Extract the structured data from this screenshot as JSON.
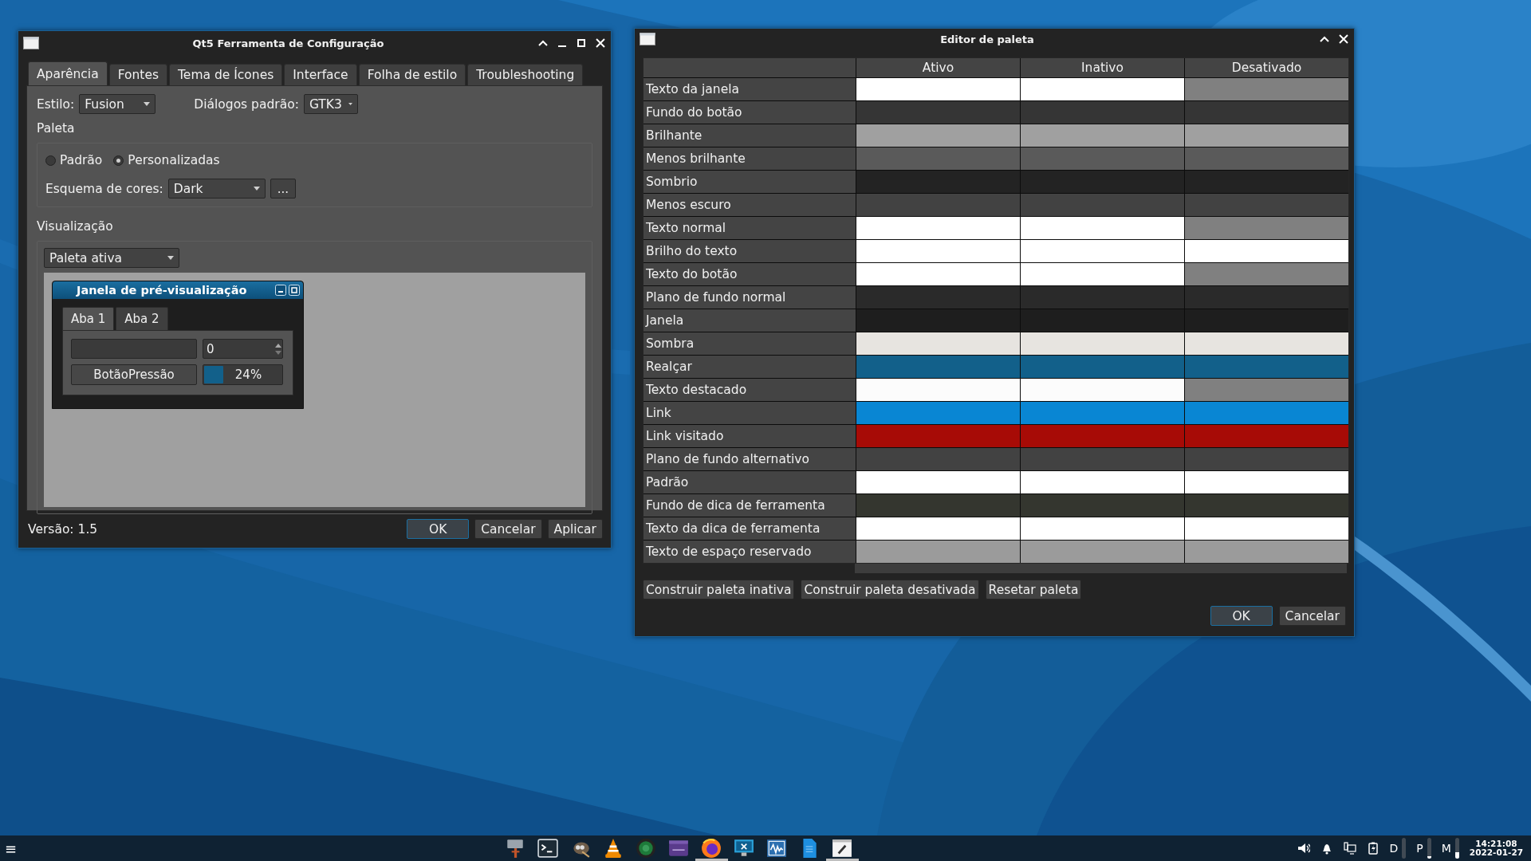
{
  "config_window": {
    "title": "Qt5 Ferramenta de Configuração",
    "tabs": [
      {
        "label": "Aparência",
        "selected": true
      },
      {
        "label": "Fontes",
        "selected": false
      },
      {
        "label": "Tema de Ícones",
        "selected": false
      },
      {
        "label": "Interface",
        "selected": false
      },
      {
        "label": "Folha de estilo",
        "selected": false
      },
      {
        "label": "Troubleshooting",
        "selected": false
      }
    ],
    "style_label": "Estilo:",
    "style_value": "Fusion",
    "dialogs_label": "Diálogos padrão:",
    "dialogs_value": "GTK3",
    "palette_heading": "Paleta",
    "palette_options": [
      {
        "label": "Padrão",
        "selected": false
      },
      {
        "label": "Personalizadas",
        "selected": true
      }
    ],
    "scheme_label": "Esquema de cores:",
    "scheme_value": "Dark",
    "scheme_button": "...",
    "preview_heading": "Visualização",
    "preview_palette": "Paleta ativa",
    "preview_window": {
      "title": "Janela de pré-visualização",
      "tabs": [
        {
          "label": "Aba 1",
          "selected": true
        },
        {
          "label": "Aba 2",
          "selected": false
        }
      ],
      "spin_value": "0",
      "push_button": "BotãoPressão",
      "progress": {
        "level": 0.24,
        "reading": "24%"
      }
    },
    "version": "Versão: 1.5",
    "buttons": [
      {
        "label": "OK",
        "default": true
      },
      {
        "label": "Cancelar",
        "default": false
      },
      {
        "label": "Aplicar",
        "default": false
      }
    ]
  },
  "palette_editor": {
    "title": "Editor de paleta",
    "columns": [
      "Ativo",
      "Inativo",
      "Desativado"
    ],
    "rows": [
      {
        "role": "Texto da janela",
        "cells": [
          {
            "color": "#ffffff"
          },
          {
            "color": "#ffffff"
          },
          {
            "color": "#808080"
          }
        ]
      },
      {
        "role": "Fundo do botão",
        "cells": [
          {
            "color": "#353535"
          },
          {
            "color": "#353535"
          },
          {
            "color": "#353535"
          }
        ]
      },
      {
        "role": "Brilhante",
        "cells": [
          {
            "color": "#a0a0a0"
          },
          {
            "color": "#a0a0a0"
          },
          {
            "color": "#a0a0a0"
          }
        ]
      },
      {
        "role": "Menos brilhante",
        "cells": [
          {
            "color": "#5a5a5a"
          },
          {
            "color": "#5a5a5a"
          },
          {
            "color": "#5a5a5a"
          }
        ]
      },
      {
        "role": "Sombrio",
        "cells": [
          {
            "color": "#232323"
          },
          {
            "color": "#232323"
          },
          {
            "color": "#232323"
          }
        ]
      },
      {
        "role": "Menos escuro",
        "cells": [
          {
            "color": "#424242"
          },
          {
            "color": "#424242"
          },
          {
            "color": "#424242"
          }
        ]
      },
      {
        "role": "Texto normal",
        "cells": [
          {
            "color": "#ffffff"
          },
          {
            "color": "#ffffff"
          },
          {
            "color": "#808080"
          }
        ]
      },
      {
        "role": "Brilho do texto",
        "cells": [
          {
            "color": "#ffffff"
          },
          {
            "color": "#ffffff"
          },
          {
            "color": "#ffffff"
          }
        ]
      },
      {
        "role": "Texto do botão",
        "cells": [
          {
            "color": "#ffffff"
          },
          {
            "color": "#ffffff"
          },
          {
            "color": "#808080"
          }
        ]
      },
      {
        "role": "Plano de fundo normal",
        "cells": [
          {
            "color": "#2a2a2a"
          },
          {
            "color": "#2a2a2a"
          },
          {
            "color": "#2a2a2a"
          }
        ]
      },
      {
        "role": "Janela",
        "cells": [
          {
            "color": "#1e1e1e"
          },
          {
            "color": "#1e1e1e"
          },
          {
            "color": "#1e1e1e"
          }
        ]
      },
      {
        "role": "Sombra",
        "cells": [
          {
            "color": "#e7e4e0"
          },
          {
            "color": "#e7e4e0"
          },
          {
            "color": "#e7e4e0"
          }
        ]
      },
      {
        "role": "Realçar",
        "cells": [
          {
            "color": "#12608a"
          },
          {
            "color": "#12608a"
          },
          {
            "color": "#12608a"
          }
        ]
      },
      {
        "role": "Texto destacado",
        "cells": [
          {
            "color": "#fcfcfc"
          },
          {
            "color": "#fcfcfc"
          },
          {
            "color": "#808080"
          }
        ]
      },
      {
        "role": "Link",
        "cells": [
          {
            "color": "#0986d3"
          },
          {
            "color": "#0986d3"
          },
          {
            "color": "#0986d3"
          }
        ]
      },
      {
        "role": "Link visitado",
        "cells": [
          {
            "color": "#a70b06"
          },
          {
            "color": "#a70b06"
          },
          {
            "color": "#a70b06"
          }
        ]
      },
      {
        "role": "Plano de fundo alternativo",
        "cells": [
          {
            "color": "#424242"
          },
          {
            "color": "#424242"
          },
          {
            "color": "#424242"
          }
        ]
      },
      {
        "role": "Padrão",
        "cells": [
          {
            "color": "#ffffff"
          },
          {
            "color": "#ffffff"
          },
          {
            "color": "#ffffff"
          }
        ]
      },
      {
        "role": "Fundo de dica de ferramenta",
        "cells": [
          {
            "color": "#34362f"
          },
          {
            "color": "#34362f"
          },
          {
            "color": "#34362f"
          }
        ]
      },
      {
        "role": "Texto da dica de ferramenta",
        "cells": [
          {
            "color": "#ffffff"
          },
          {
            "color": "#ffffff"
          },
          {
            "color": "#ffffff"
          }
        ]
      },
      {
        "role": "Texto de espaço reservado",
        "cells": [
          {
            "color": "#9b9b9b"
          },
          {
            "color": "#9b9b9b"
          },
          {
            "color": "#9b9b9b"
          }
        ]
      }
    ],
    "actions": [
      "Construir paleta inativa",
      "Construir paleta desativada",
      "Resetar paleta"
    ],
    "buttons": [
      {
        "label": "OK",
        "default": true
      },
      {
        "label": "Cancelar",
        "default": false
      }
    ]
  },
  "taskbar": {
    "menu": "≡",
    "apps": [
      {
        "kind": "signpost",
        "active": false
      },
      {
        "kind": "terminal",
        "active": false
      },
      {
        "kind": "brush",
        "active": false
      },
      {
        "kind": "cone",
        "active": false
      },
      {
        "kind": "lens",
        "active": false
      },
      {
        "kind": "clapper",
        "active": false
      },
      {
        "kind": "globe",
        "active": true
      },
      {
        "kind": "monitor",
        "active": false
      },
      {
        "kind": "wave",
        "active": false
      },
      {
        "kind": "document",
        "active": false
      },
      {
        "kind": "pen",
        "active": true
      }
    ],
    "tray": [
      {
        "kind": "speaker"
      },
      {
        "kind": "bell"
      },
      {
        "kind": "network"
      },
      {
        "kind": "battery"
      }
    ],
    "monitors": [
      {
        "label": "D"
      },
      {
        "label": "P",
        "level": 0.12
      },
      {
        "label": "M",
        "level": 0.3
      }
    ],
    "time": "14:21:08",
    "date": "2022-01-27"
  }
}
